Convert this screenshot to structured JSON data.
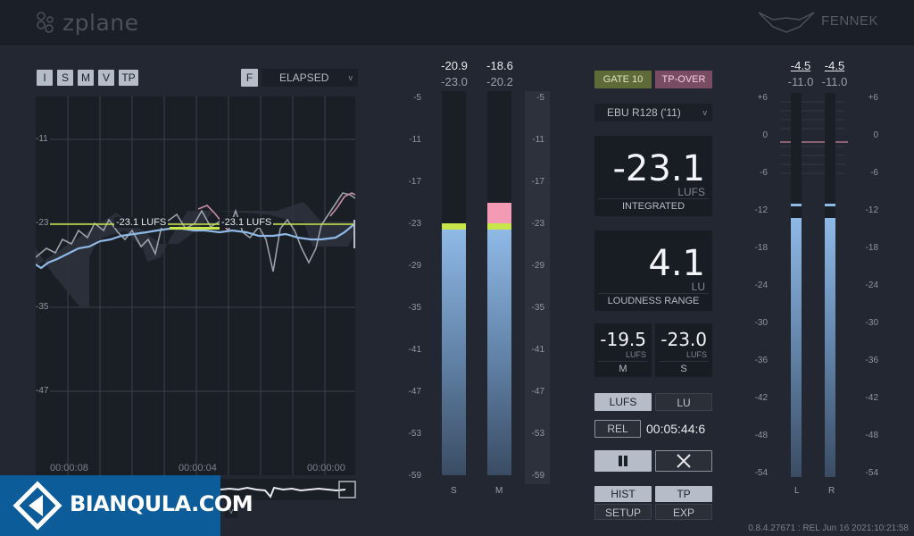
{
  "header": {
    "brand": "zplane",
    "product": "FENNEK"
  },
  "left": {
    "mode_buttons": [
      "I",
      "S",
      "M",
      "V",
      "TP"
    ],
    "f_button": "F",
    "time_dropdown": "ELAPSED",
    "graph_scale": [
      "-11",
      "-23",
      "-35",
      "-47"
    ],
    "graph_time_labels": [
      "00:00:08",
      "00:00:04",
      "00:00:00"
    ],
    "target_label_1": "-23.1 LUFS",
    "target_label_2": "-23.1 LUFS"
  },
  "center_meter": {
    "short_term_max": "-20.9",
    "short_term": "-23.0",
    "momentary_max": "-18.6",
    "momentary": "-20.2",
    "scale": [
      "-5",
      "-11",
      "-17",
      "-23",
      "-29",
      "-35",
      "-41",
      "-47",
      "-53",
      "-59"
    ],
    "col_labels": [
      "S",
      "M"
    ],
    "s_level_lu": -23.0,
    "m_level_lu": -20.2
  },
  "status": {
    "gate": "GATE 10",
    "tp_over": "TP-OVER",
    "standard": "EBU R128 ('11)"
  },
  "integrated": {
    "value": "-23.1",
    "unit": "LUFS",
    "label": "INTEGRATED"
  },
  "loudness_range": {
    "value": "4.1",
    "unit": "LU",
    "label": "LOUDNESS RANGE"
  },
  "small_readouts": [
    {
      "value": "-19.5",
      "unit": "LUFS",
      "label": "M"
    },
    {
      "value": "-23.0",
      "unit": "LUFS",
      "label": "S"
    }
  ],
  "unit_toggle": {
    "lufs": "LUFS",
    "lu": "LU"
  },
  "rel": {
    "label": "REL",
    "time": "00:05:44:6"
  },
  "bottom_buttons": {
    "hist": "HIST",
    "tp": "TP",
    "setup": "SETUP",
    "exp": "EXP"
  },
  "true_peak": {
    "l_max": "-4.5",
    "l": "-11.0",
    "r_max": "-4.5",
    "r": "-11.0",
    "scale": [
      "+6",
      "0",
      "-6",
      "-12",
      "-18",
      "-24",
      "-30",
      "-36",
      "-42",
      "-48",
      "-54"
    ],
    "col_labels": [
      "L",
      "R"
    ]
  },
  "footer": {
    "version": "0.8.4.27671 : REL Jun 16 2021:10:21:58"
  },
  "watermark": {
    "text": "BIANQULA.COM"
  },
  "colors": {
    "accent_blue": "#8fb9e6",
    "yellow_green": "#c8e64a",
    "pink": "#f39ab5"
  }
}
